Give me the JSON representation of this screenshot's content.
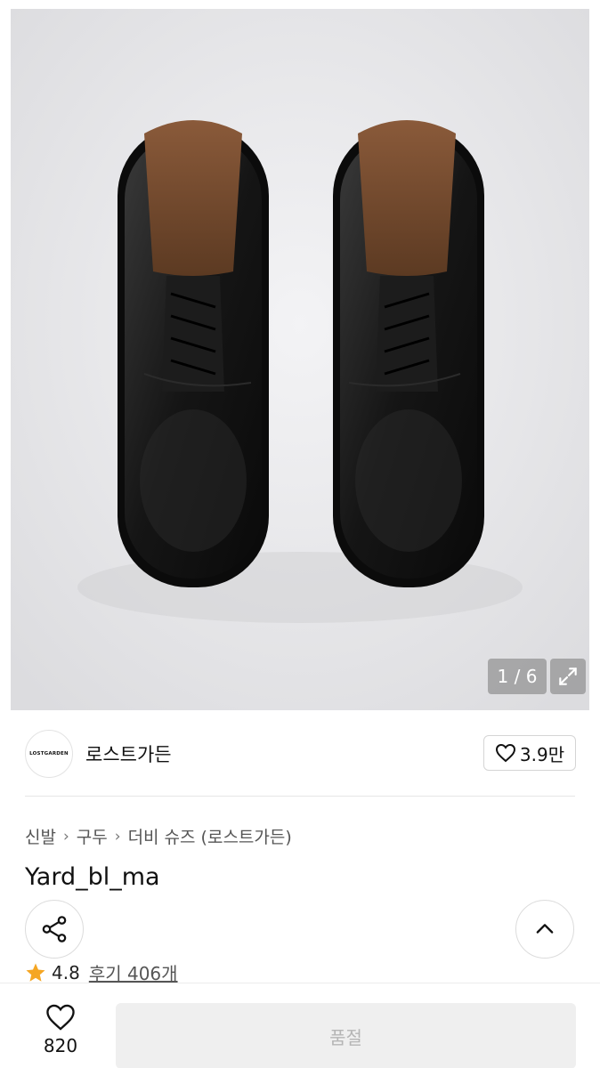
{
  "gallery": {
    "counter": "1 / 6",
    "icons": {
      "expand": "expand-icon"
    }
  },
  "brand": {
    "logo_text": "LOSTGARDEN",
    "name": "로스트가든",
    "like_count": "3.9만",
    "icons": {
      "like": "heart-outline-icon"
    }
  },
  "breadcrumb": {
    "items": [
      "신발",
      "구두",
      "더비 슈즈 (로스트가든)"
    ],
    "separator_icon": "chevron-right-icon"
  },
  "product": {
    "title": "Yard_bl_ma",
    "rating": "4.8",
    "reviews": "후기 406개",
    "icons": {
      "share": "share-icon",
      "scroll_top": "chevron-up-icon",
      "star": "star-icon"
    }
  },
  "bottom_bar": {
    "wish_count": "820",
    "soldout_label": "품절",
    "icons": {
      "wish": "heart-outline-icon"
    }
  },
  "colors": {
    "star": "#f5a623",
    "soldout_bg": "#efefef",
    "soldout_text": "#b5b5b5"
  }
}
